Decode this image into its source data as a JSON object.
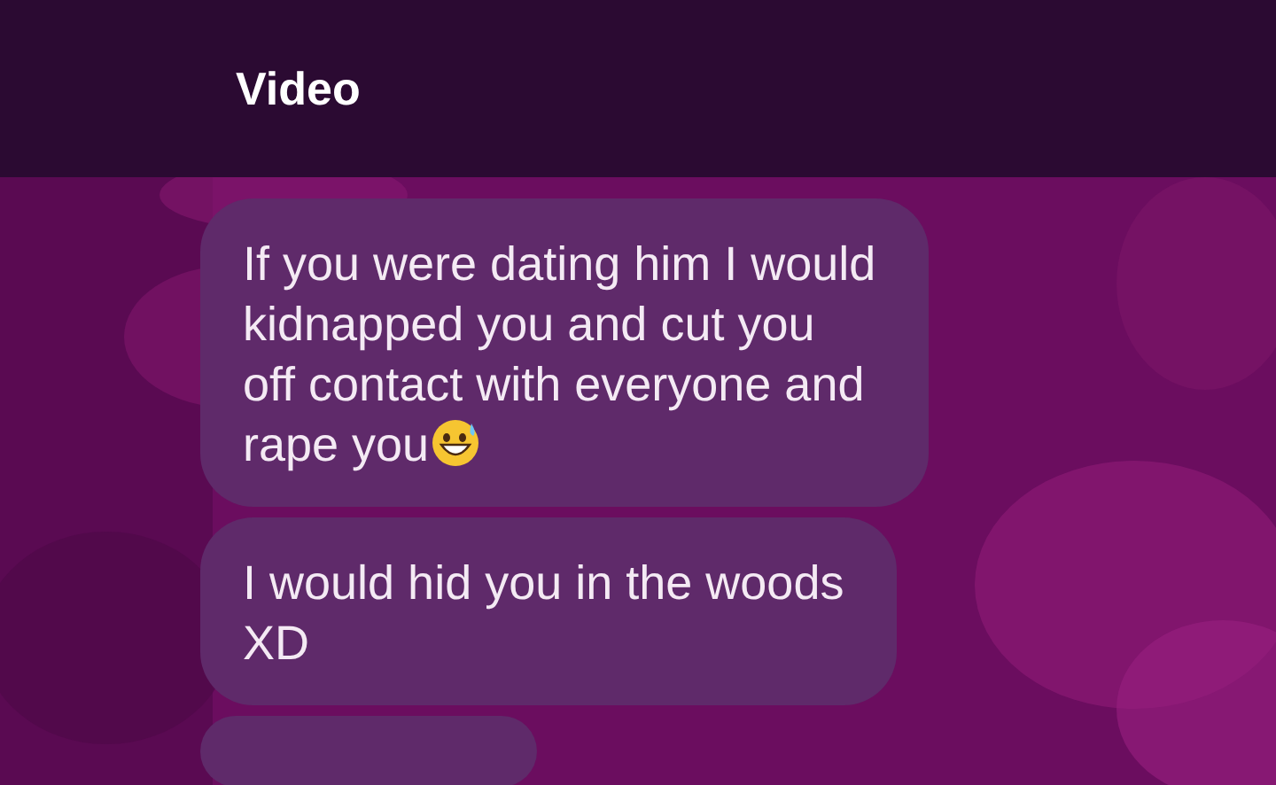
{
  "header": {
    "title": "Video"
  },
  "messages": [
    {
      "lines": [
        "If you were dating him I would",
        "kidnapped you and cut you",
        "off contact with everyone and",
        "rape you"
      ],
      "emoji": true
    },
    {
      "lines": [
        "I would hid you in the woods",
        "XD"
      ],
      "emoji": false
    }
  ]
}
